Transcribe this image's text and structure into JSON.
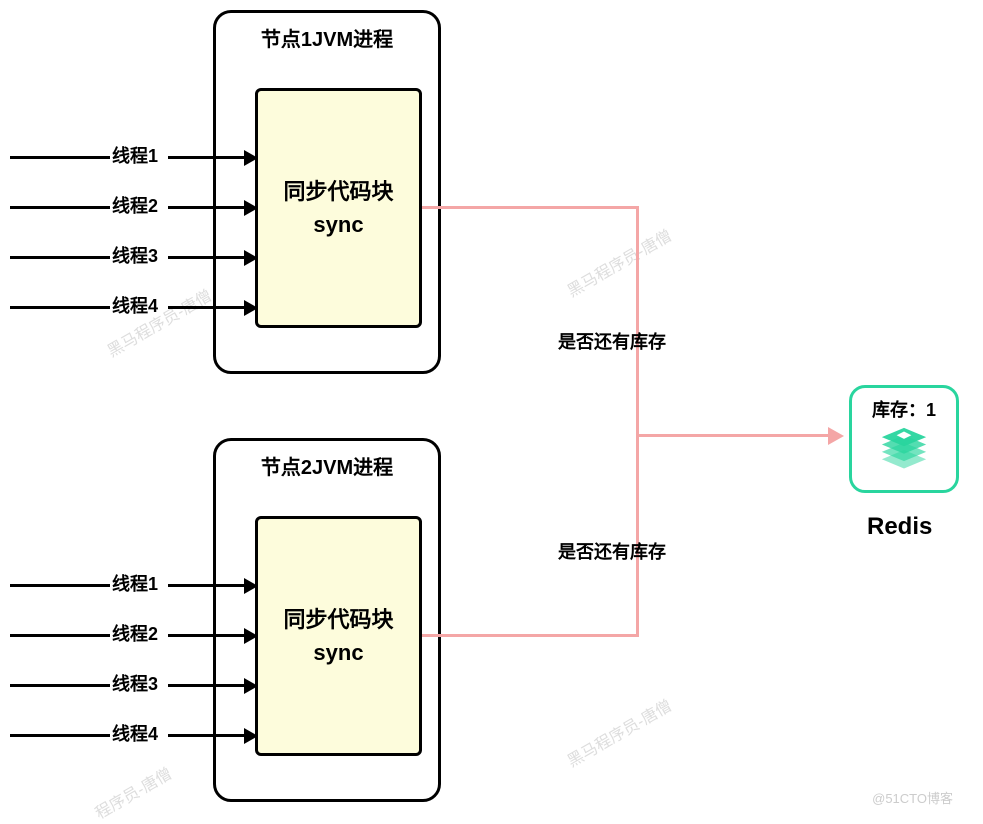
{
  "jvm1": {
    "title": "节点1JVM进程",
    "sync_line1": "同步代码块",
    "sync_line2": "sync",
    "threads": [
      "线程1",
      "线程2",
      "线程3",
      "线程4"
    ]
  },
  "jvm2": {
    "title": "节点2JVM进程",
    "sync_line1": "同步代码块",
    "sync_line2": "sync",
    "threads": [
      "线程1",
      "线程2",
      "线程3",
      "线程4"
    ]
  },
  "question1": "是否还有库存",
  "question2": "是否还有库存",
  "redis": {
    "stock_label": "库存：1",
    "name": "Redis"
  },
  "watermarks": {
    "w1": "黑马程序员-唐僧",
    "w2": "黑马程序员-唐僧",
    "w3": "黑马程序员-唐僧",
    "w4": "程序员-唐僧",
    "cto": "@51CTO博客"
  }
}
